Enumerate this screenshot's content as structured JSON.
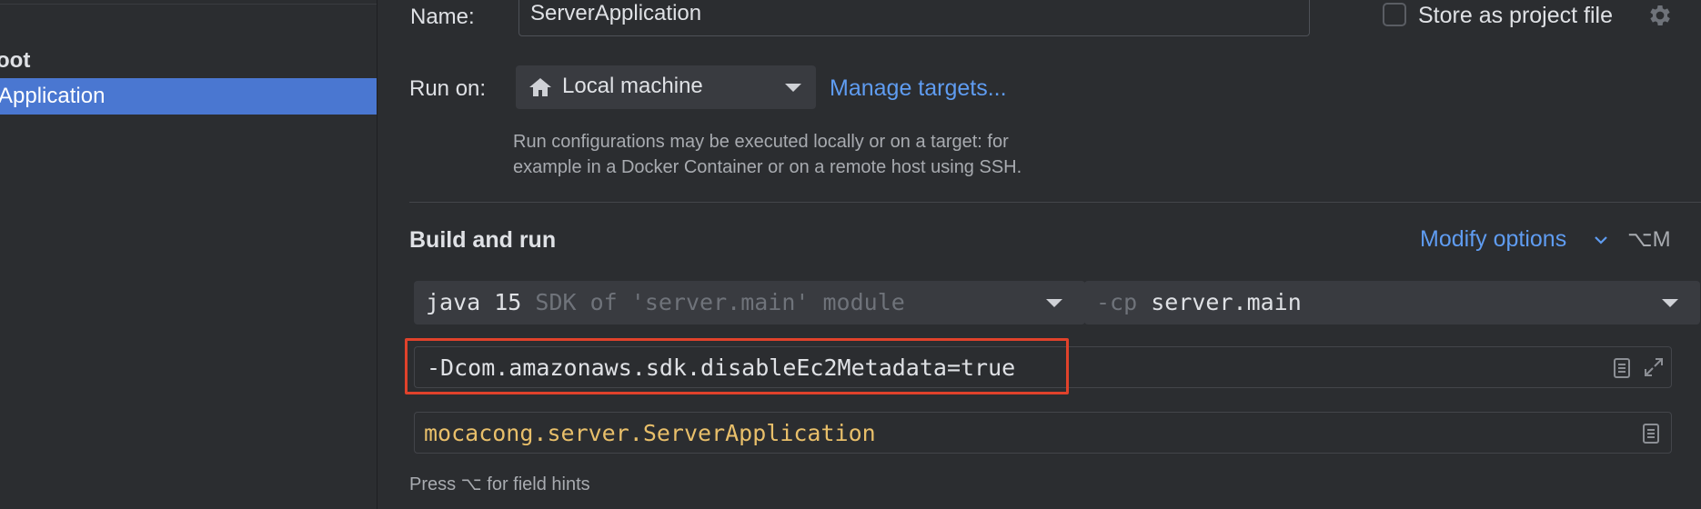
{
  "sidebar": {
    "group_label": "oot",
    "selected_label": "Application"
  },
  "form": {
    "name_label": "Name:",
    "name_value": "ServerApplication",
    "store_label": "Store as project file",
    "store_checked": false,
    "run_on_label": "Run on:",
    "run_on_value": "Local machine",
    "manage_targets": "Manage targets...",
    "run_on_hint_line1": "Run configurations may be executed locally or on a target: for",
    "run_on_hint_line2": "example in a Docker Container or on a remote host using SSH."
  },
  "build": {
    "title": "Build and run",
    "modify_options": "Modify options",
    "modify_shortcut": "⌥M",
    "jdk_main": "java 15",
    "jdk_sub": "SDK of 'server.main' module",
    "cp_flag": "-cp",
    "cp_value": "server.main",
    "vm_options": "-Dcom.amazonaws.sdk.disableEc2Metadata=true",
    "main_class": "mocacong.server.ServerApplication",
    "field_hints": "Press ⌥ for field hints"
  },
  "colors": {
    "accent_link": "#5f9cf1",
    "selection": "#4a77d1",
    "highlight_border": "#e0422b",
    "main_class_text": "#e8bf6a"
  },
  "icons": [
    "house-icon",
    "chevron-down-icon",
    "gear-icon",
    "document-icon",
    "expand-icon"
  ]
}
